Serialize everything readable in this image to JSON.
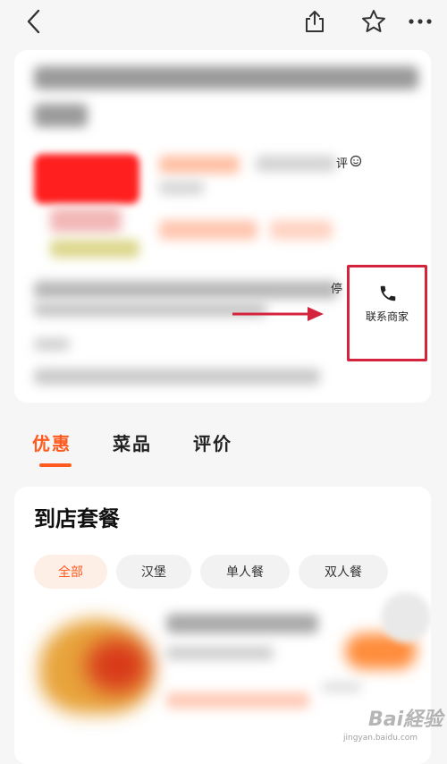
{
  "header": {
    "back_icon": "chevron-left-icon",
    "share_icon": "share-icon",
    "favorite_icon": "star-icon",
    "more_icon": "more-dots-icon"
  },
  "merchant_card": {
    "reviews_label": "评",
    "side_char": "停",
    "contact_label": "联系商家"
  },
  "tabs": [
    {
      "label": "优惠",
      "active": true
    },
    {
      "label": "菜品",
      "active": false
    },
    {
      "label": "评价",
      "active": false
    }
  ],
  "section": {
    "title": "到店套餐",
    "filters": [
      {
        "label": "全部",
        "selected": true
      },
      {
        "label": "汉堡",
        "selected": false
      },
      {
        "label": "单人餐",
        "selected": false
      },
      {
        "label": "双人餐",
        "selected": false
      }
    ]
  },
  "watermark": {
    "brand": "Bai経验",
    "url": "jingyan.baidu.com"
  },
  "colors": {
    "accent": "#ff5a1f",
    "highlight_box": "#d4233c"
  }
}
